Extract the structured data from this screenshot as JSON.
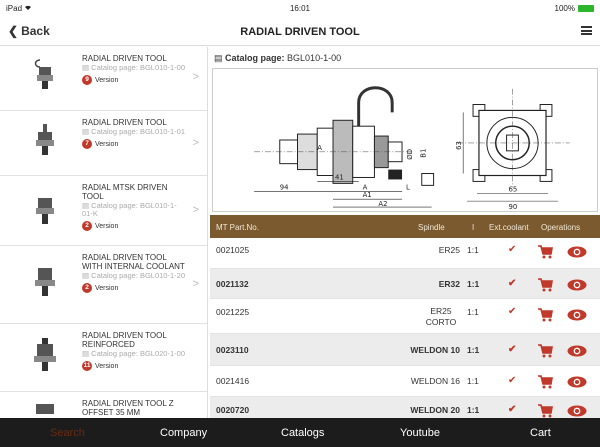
{
  "status": {
    "device": "iPad",
    "wifi": "wifi-icon",
    "time": "16:01",
    "battery": "100%"
  },
  "nav": {
    "back": "Back",
    "title": "RADIAL DRIVEN TOOL"
  },
  "sidebar": {
    "items": [
      {
        "title": "RADIAL DRIVEN TOOL",
        "catalog": "Catalog page: BGL010-1-00",
        "badge": "9",
        "version": "Version"
      },
      {
        "title": "RADIAL DRIVEN TOOL",
        "catalog": "Catalog page: BGL010-1-01",
        "badge": "7",
        "version": "Version"
      },
      {
        "title": "RADIAL MTSK DRIVEN TOOL",
        "catalog": "Catalog page: BGL010-1-01-K",
        "badge": "2",
        "version": "Version"
      },
      {
        "title": "RADIAL DRIVEN TOOL WITH INTERNAL COOLANT",
        "catalog": "Catalog page: BGL010-1-20",
        "badge": "2",
        "version": "Version"
      },
      {
        "title": "RADIAL DRIVEN TOOL REINFORCED",
        "catalog": "Catalog page: BGL020-1-00",
        "badge": "11",
        "version": "Version"
      },
      {
        "title": "RADIAL DRIVEN TOOL Z OFFSET 35 mm",
        "catalog": "",
        "badge": "",
        "version": ""
      }
    ]
  },
  "main": {
    "catalog_label": "Catalog page:",
    "catalog_value": "BGL010-1-00",
    "drawing_labels": {
      "d94": "94",
      "dA": "A",
      "dA1": "A1",
      "dA2": "A2",
      "d41": "41",
      "dL": "L",
      "d65": "65",
      "d90": "90",
      "dD": "ØD",
      "dB": "B1",
      "d63": "63"
    }
  },
  "table": {
    "headers": {
      "part": "MT Part.No.",
      "spindle": "Spindle",
      "ratio": "I",
      "coolant": "Ext.coolant",
      "operations": "Operations"
    },
    "rows": [
      {
        "part": "0021025",
        "spindle": "ER25",
        "ratio": "1:1"
      },
      {
        "part": "0021132",
        "spindle": "ER32",
        "ratio": "1:1"
      },
      {
        "part": "0021225",
        "spindle": "ER25 CORTO",
        "ratio": "1:1"
      },
      {
        "part": "0023110",
        "spindle": "WELDON 10",
        "ratio": "1:1"
      },
      {
        "part": "0021416",
        "spindle": "WELDON 16",
        "ratio": "1:1"
      },
      {
        "part": "0020720",
        "spindle": "WELDON 20",
        "ratio": "1:1"
      }
    ]
  },
  "tabs": {
    "search": "Search",
    "company": "Company",
    "catalogs": "Catalogs",
    "youtube": "Youtube",
    "cart": "Cart"
  },
  "colors": {
    "accent": "#c0392b",
    "table_header": "#7a5a2e",
    "tabbar": "#1c1c1c"
  }
}
